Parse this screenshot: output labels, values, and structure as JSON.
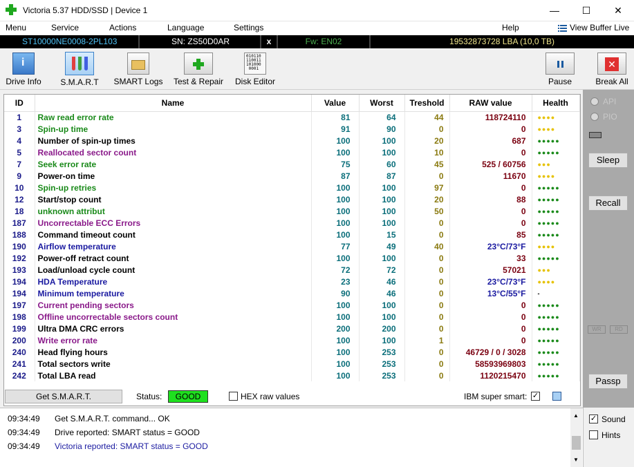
{
  "window": {
    "title": "Victoria 5.37 HDD/SSD | Device 1",
    "minimize": "—",
    "maximize": "☐",
    "close": "✕"
  },
  "menu": {
    "items": [
      "Menu",
      "Service",
      "Actions",
      "Language",
      "Settings",
      "Help"
    ],
    "view_buffer": "View Buffer Live"
  },
  "drive": {
    "model": "ST10000NE0008-2PL103",
    "serial": "SN: ZS50D0AR",
    "close_x": "x",
    "firmware": "Fw: EN02",
    "capacity": "19532873728 LBA (10,0 TB)"
  },
  "toolbar": {
    "drive_info": "Drive Info",
    "smart": "S.M.A.R.T",
    "smart_logs": "SMART Logs",
    "test_repair": "Test & Repair",
    "disk_editor": "Disk Editor",
    "pause": "Pause",
    "break_all": "Break All"
  },
  "table": {
    "headers": [
      "ID",
      "Name",
      "Value",
      "Worst",
      "Treshold",
      "RAW value",
      "Health"
    ],
    "rows": [
      {
        "id": "1",
        "name": "Raw read error rate",
        "value": "81",
        "worst": "64",
        "thr": "44",
        "raw": "118724110",
        "health": "●●●●",
        "name_color": "#1a8a1a",
        "health_color": "#e6c200"
      },
      {
        "id": "3",
        "name": "Spin-up time",
        "value": "91",
        "worst": "90",
        "thr": "0",
        "raw": "0",
        "health": "●●●●",
        "name_color": "#1a8a1a",
        "health_color": "#e6c200"
      },
      {
        "id": "4",
        "name": "Number of spin-up times",
        "value": "100",
        "worst": "100",
        "thr": "20",
        "raw": "687",
        "health": "●●●●●",
        "name_color": "#000000",
        "health_color": "#1a8a1a"
      },
      {
        "id": "5",
        "name": "Reallocated sector count",
        "value": "100",
        "worst": "100",
        "thr": "10",
        "raw": "0",
        "health": "●●●●●",
        "name_color": "#8a1a8a",
        "health_color": "#1a8a1a"
      },
      {
        "id": "7",
        "name": "Seek error rate",
        "value": "75",
        "worst": "60",
        "thr": "45",
        "raw": "525 / 60756",
        "health": "●●●",
        "name_color": "#1a8a1a",
        "health_color": "#e6c200"
      },
      {
        "id": "9",
        "name": "Power-on time",
        "value": "87",
        "worst": "87",
        "thr": "0",
        "raw": "11670",
        "health": "●●●●",
        "name_color": "#000000",
        "health_color": "#e6c200"
      },
      {
        "id": "10",
        "name": "Spin-up retries",
        "value": "100",
        "worst": "100",
        "thr": "97",
        "raw": "0",
        "health": "●●●●●",
        "name_color": "#1a8a1a",
        "health_color": "#1a8a1a"
      },
      {
        "id": "12",
        "name": "Start/stop count",
        "value": "100",
        "worst": "100",
        "thr": "20",
        "raw": "88",
        "health": "●●●●●",
        "name_color": "#000000",
        "health_color": "#1a8a1a"
      },
      {
        "id": "18",
        "name": "unknown attribut",
        "value": "100",
        "worst": "100",
        "thr": "50",
        "raw": "0",
        "health": "●●●●●",
        "name_color": "#1a8a1a",
        "health_color": "#1a8a1a"
      },
      {
        "id": "187",
        "name": "Uncorrectable ECC Errors",
        "value": "100",
        "worst": "100",
        "thr": "0",
        "raw": "0",
        "health": "●●●●●",
        "name_color": "#8a1a8a",
        "health_color": "#1a8a1a"
      },
      {
        "id": "188",
        "name": "Command timeout count",
        "value": "100",
        "worst": "15",
        "thr": "0",
        "raw": "85",
        "health": "●●●●●",
        "name_color": "#000000",
        "health_color": "#1a8a1a"
      },
      {
        "id": "190",
        "name": "Airflow temperature",
        "value": "77",
        "worst": "49",
        "thr": "40",
        "raw": "23°C/73°F",
        "health": "●●●●",
        "name_color": "#1a1aa0",
        "health_color": "#e6c200",
        "raw_color": "#1a1aa0"
      },
      {
        "id": "192",
        "name": "Power-off retract count",
        "value": "100",
        "worst": "100",
        "thr": "0",
        "raw": "33",
        "health": "●●●●●",
        "name_color": "#000000",
        "health_color": "#1a8a1a"
      },
      {
        "id": "193",
        "name": "Load/unload cycle count",
        "value": "72",
        "worst": "72",
        "thr": "0",
        "raw": "57021",
        "health": "●●●",
        "name_color": "#000000",
        "health_color": "#e6c200"
      },
      {
        "id": "194",
        "name": "HDA Temperature",
        "value": "23",
        "worst": "46",
        "thr": "0",
        "raw": "23°C/73°F",
        "health": "●●●●",
        "name_color": "#1a1aa0",
        "health_color": "#e6c200",
        "raw_color": "#1a1aa0"
      },
      {
        "id": "194",
        "name": "Minimum temperature",
        "value": "90",
        "worst": "46",
        "thr": "0",
        "raw": "13°C/55°F",
        "health": "-",
        "name_color": "#1a1aa0",
        "health_color": "#000000",
        "raw_color": "#1a1aa0"
      },
      {
        "id": "197",
        "name": "Current pending sectors",
        "value": "100",
        "worst": "100",
        "thr": "0",
        "raw": "0",
        "health": "●●●●●",
        "name_color": "#8a1a8a",
        "health_color": "#1a8a1a"
      },
      {
        "id": "198",
        "name": "Offline uncorrectable sectors count",
        "value": "100",
        "worst": "100",
        "thr": "0",
        "raw": "0",
        "health": "●●●●●",
        "name_color": "#8a1a8a",
        "health_color": "#1a8a1a"
      },
      {
        "id": "199",
        "name": "Ultra DMA CRC errors",
        "value": "200",
        "worst": "200",
        "thr": "0",
        "raw": "0",
        "health": "●●●●●",
        "name_color": "#000000",
        "health_color": "#1a8a1a"
      },
      {
        "id": "200",
        "name": "Write error rate",
        "value": "100",
        "worst": "100",
        "thr": "1",
        "raw": "0",
        "health": "●●●●●",
        "name_color": "#8a1a8a",
        "health_color": "#1a8a1a"
      },
      {
        "id": "240",
        "name": "Head flying hours",
        "value": "100",
        "worst": "253",
        "thr": "0",
        "raw": "46729 / 0 / 3028",
        "health": "●●●●●",
        "name_color": "#000000",
        "health_color": "#1a8a1a"
      },
      {
        "id": "241",
        "name": "Total sectors write",
        "value": "100",
        "worst": "253",
        "thr": "0",
        "raw": "58593969803",
        "health": "●●●●●",
        "name_color": "#000000",
        "health_color": "#1a8a1a"
      },
      {
        "id": "242",
        "name": "Total LBA read",
        "value": "100",
        "worst": "253",
        "thr": "0",
        "raw": "1120215470",
        "health": "●●●●●",
        "name_color": "#000000",
        "health_color": "#1a8a1a"
      }
    ]
  },
  "status": {
    "get_smart": "Get S.M.A.R.T.",
    "status_label": "Status:",
    "status_value": "GOOD",
    "hex_raw": "HEX raw values",
    "ibm_super_smart": "IBM super smart:",
    "ibm_check": "✓"
  },
  "log": [
    {
      "time": "09:34:49",
      "text": "Get S.M.A.R.T. command... OK",
      "color": "#000000"
    },
    {
      "time": "09:34:49",
      "text": "Drive reported: SMART status = GOOD",
      "color": "#000000"
    },
    {
      "time": "09:34:49",
      "text": "Victoria reported: SMART status = GOOD",
      "color": "#1a1aa0"
    }
  ],
  "side": {
    "api": "API",
    "pio": "PIO",
    "sleep": "Sleep",
    "recall": "Recall",
    "wr": "WR",
    "rd": "RD",
    "passp": "Passp",
    "sound": "Sound",
    "sound_check": "✓",
    "hints": "Hints"
  }
}
